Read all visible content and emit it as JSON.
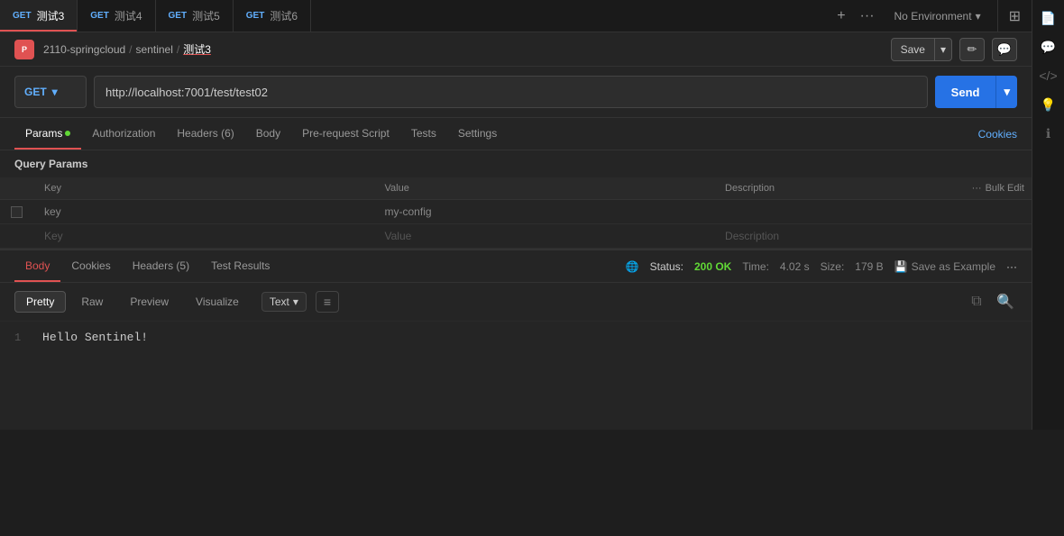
{
  "tabs": [
    {
      "id": "tab1",
      "method": "GET",
      "name": "测试3",
      "active": true
    },
    {
      "id": "tab2",
      "method": "GET",
      "name": "测试4",
      "active": false
    },
    {
      "id": "tab3",
      "method": "GET",
      "name": "测试5",
      "active": false
    },
    {
      "id": "tab4",
      "method": "GET",
      "name": "测试6",
      "active": false
    }
  ],
  "env_selector": {
    "label": "No Environment",
    "arrow": "▾"
  },
  "breadcrumb": {
    "logo_text": "P",
    "parts": [
      "2110-springcloud",
      "sentinel",
      "测试3"
    ]
  },
  "save_button": {
    "label": "Save",
    "arrow": "▾"
  },
  "icons": {
    "edit": "✏",
    "comment": "💬",
    "code": "</>",
    "light": "💡",
    "info": "ℹ",
    "document": "📄",
    "chat": "💬",
    "save": "💾",
    "more": "···"
  },
  "request": {
    "method": "GET",
    "method_arrow": "▾",
    "url": "http://localhost:7001/test/test02",
    "send_label": "Send",
    "send_arrow": "▾"
  },
  "request_tabs": [
    {
      "id": "params",
      "label": "Params",
      "active": true,
      "dot": true
    },
    {
      "id": "authorization",
      "label": "Authorization",
      "active": false
    },
    {
      "id": "headers",
      "label": "Headers (6)",
      "active": false
    },
    {
      "id": "body",
      "label": "Body",
      "active": false
    },
    {
      "id": "prerequest",
      "label": "Pre-request Script",
      "active": false
    },
    {
      "id": "tests",
      "label": "Tests",
      "active": false
    },
    {
      "id": "settings",
      "label": "Settings",
      "active": false
    }
  ],
  "cookies_label": "Cookies",
  "query_params": {
    "title": "Query Params",
    "columns": [
      "Key",
      "Value",
      "Description"
    ],
    "rows": [
      {
        "checked": false,
        "key": "key",
        "value": "my-config",
        "description": ""
      }
    ],
    "placeholder_row": {
      "key": "Key",
      "value": "Value",
      "description": "Description"
    },
    "bulk_edit_label": "Bulk Edit"
  },
  "response": {
    "tabs": [
      {
        "id": "body",
        "label": "Body",
        "active": true
      },
      {
        "id": "cookies",
        "label": "Cookies",
        "active": false
      },
      {
        "id": "headers",
        "label": "Headers (5)",
        "active": false
      },
      {
        "id": "testresults",
        "label": "Test Results",
        "active": false
      }
    ],
    "status_label": "Status:",
    "status_value": "200 OK",
    "time_label": "Time:",
    "time_value": "4.02 s",
    "size_label": "Size:",
    "size_value": "179 B",
    "save_example_label": "Save as Example",
    "more": "···"
  },
  "body_format": {
    "buttons": [
      "Pretty",
      "Raw",
      "Preview",
      "Visualize"
    ],
    "active": "Pretty",
    "text_label": "Text",
    "text_arrow": "▾"
  },
  "code_content": {
    "line": 1,
    "text": "Hello Sentinel!"
  }
}
